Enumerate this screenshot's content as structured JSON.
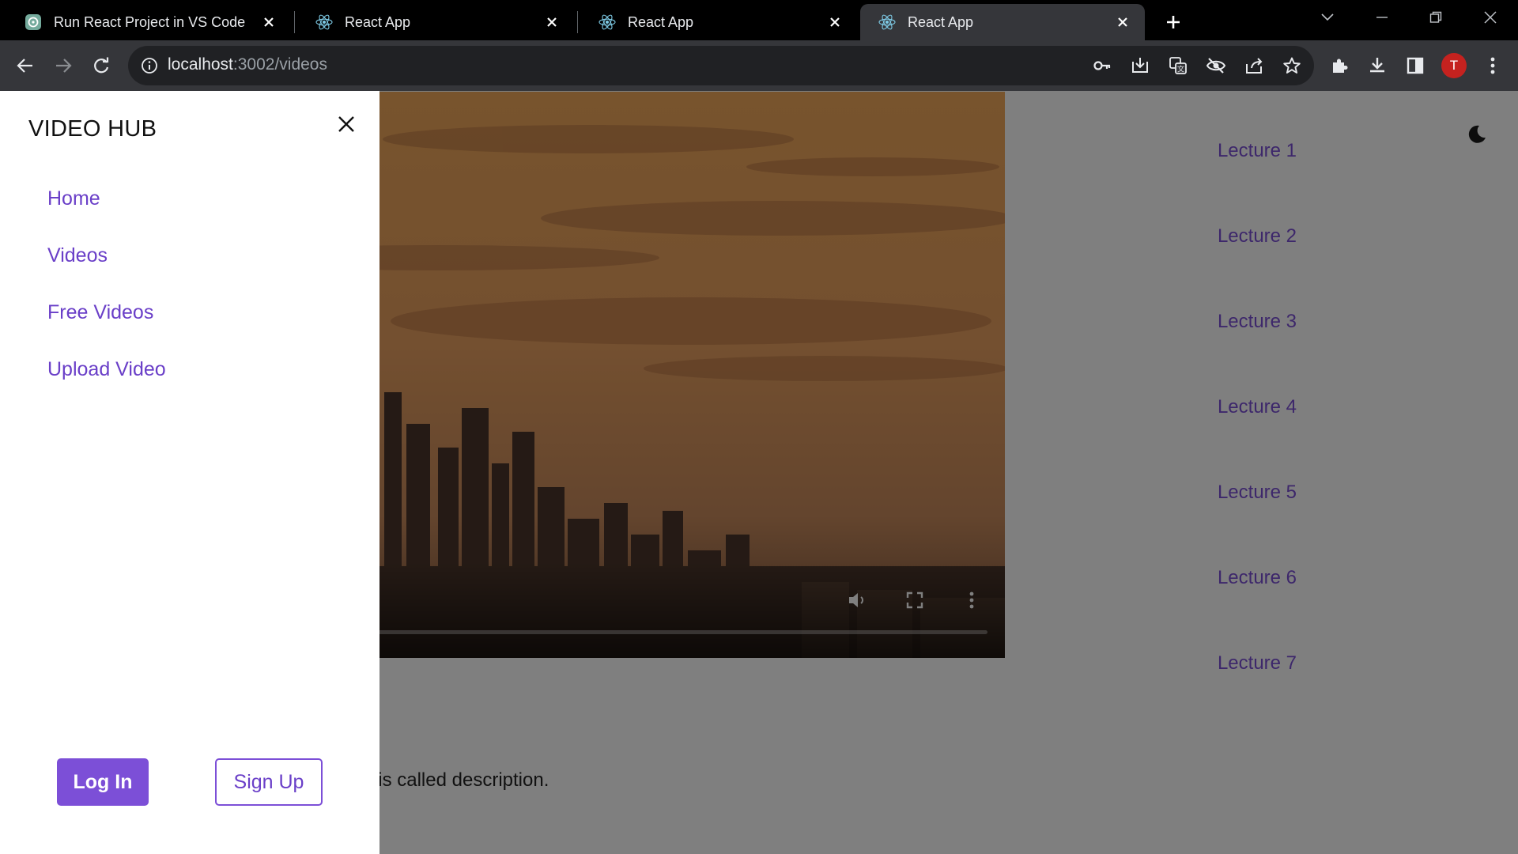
{
  "browser": {
    "tabs": [
      {
        "title": "Run React Project in VS Code",
        "icon": "chatgpt-icon",
        "active": false
      },
      {
        "title": "React App",
        "icon": "react-icon",
        "active": false
      },
      {
        "title": "React App",
        "icon": "react-icon",
        "active": false
      },
      {
        "title": "React App",
        "icon": "react-icon",
        "active": true
      }
    ],
    "url": {
      "host": "localhost",
      "path": ":3002/videos"
    },
    "profile_initial": "T",
    "accent_colors": {
      "profile": "#c5221f"
    }
  },
  "app": {
    "brand": "VIDEO HUB",
    "nav": [
      {
        "label": "Home"
      },
      {
        "label": "Videos"
      },
      {
        "label": "Free Videos"
      },
      {
        "label": "Upload Video"
      }
    ],
    "login_label": "Log In",
    "signup_label": "Sign Up",
    "lectures": [
      {
        "label": "Lecture 1"
      },
      {
        "label": "Lecture 2"
      },
      {
        "label": "Lecture 3"
      },
      {
        "label": "Lecture 4"
      },
      {
        "label": "Lecture 5"
      },
      {
        "label": "Lecture 6"
      },
      {
        "label": "Lecture 7"
      }
    ],
    "description_visible": "mo. This is called description.",
    "video_progress_percent": 0,
    "colors": {
      "accent": "#7c4fd7",
      "link": "#7b4fd6",
      "overlay": "rgba(0,0,0,0.5)"
    }
  }
}
